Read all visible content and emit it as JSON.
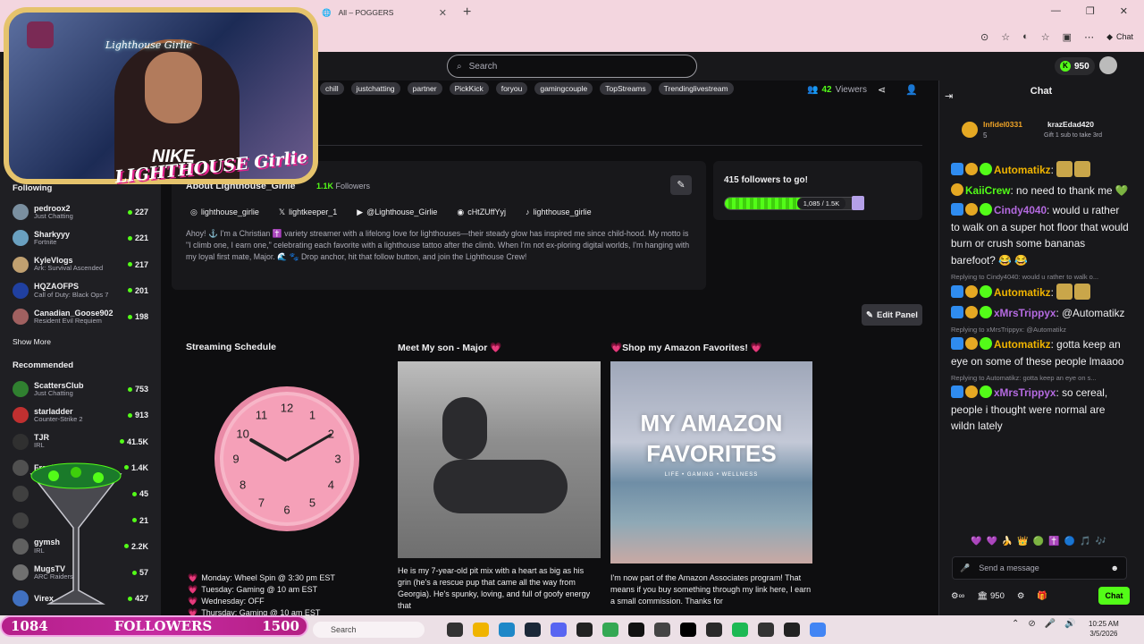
{
  "browser": {
    "tab_title": "All – POGGERS",
    "chat_label": "Chat"
  },
  "topbar": {
    "search_placeholder": "Search",
    "points": "950"
  },
  "webcam": {
    "neon_sign": "Lighthouse Girlie",
    "shirt_text": "NIKE",
    "overlay_logo": "LIGHTHOUSE Girlie"
  },
  "stream": {
    "tags": [
      "chill",
      "justchatting",
      "partner",
      "PickKick",
      "foryou",
      "gamingcouple",
      "TopStreams",
      "Trendinglivestream"
    ],
    "viewers_count": "42",
    "viewers_label": "Viewers"
  },
  "about": {
    "title": "About Lighthouse_Girlie",
    "followers_count": "1.1K",
    "followers_label": "Followers",
    "socials": [
      {
        "icon": "instagram-icon",
        "label": "lighthouse_girlie"
      },
      {
        "icon": "x-icon",
        "label": "lightkeeper_1"
      },
      {
        "icon": "youtube-icon",
        "label": "@Lighthouse_Girlie"
      },
      {
        "icon": "discord-icon",
        "label": "cHtZUffYyj"
      },
      {
        "icon": "tiktok-icon",
        "label": "lighthouse_girlie"
      }
    ],
    "bio": "Ahoy! ⚓ I'm a Christian ✝️ variety streamer with a lifelong love for lighthouses—their steady glow has inspired me since child-hood. My motto is \"I climb one, I earn one,\" celebrating each favorite with a lighthouse tattoo after the climb. When I'm not ex-ploring digital worlds, I'm hanging with my loyal first mate, Major. 🌊 🐾 Drop anchor, hit that follow button, and join the Lighthouse Crew!"
  },
  "goal": {
    "title": "415 followers to go!",
    "progress_label": "1,085 / 1.5K",
    "progress_fraction": 0.72
  },
  "edit_panel_label": "Edit Panel",
  "panels": {
    "schedule_title": "Streaming Schedule",
    "schedule": [
      "Monday: Wheel Spin @ 3:30 pm EST",
      "Tuesday: Gaming @ 10 am EST",
      "Wednesday: OFF",
      "Thursday: Gaming @ 10 am EST"
    ],
    "clock_numbers": [
      "12",
      "1",
      "2",
      "3",
      "4",
      "5",
      "6",
      "7",
      "8",
      "9",
      "10",
      "11"
    ],
    "son_title": "Meet My son - Major 💗",
    "son_text": "He is my 7-year-old pit mix with a heart as big as his grin (he's a rescue pup that came all the way from Georgia). He's spunky, loving, and full of goofy energy that",
    "amazon_title": "💗Shop my Amazon Favorites! 💗",
    "amazon_img_title": "MY AMAZON FAVORITES",
    "amazon_img_sub": "LIFE • GAMING • WELLNESS",
    "amazon_text": "I'm now part of the Amazon Associates program! That means if you buy something through my link here, I earn a small commission. Thanks for"
  },
  "sidebar": {
    "following_title": "Following",
    "following": [
      {
        "name": "pedroox2",
        "game": "Just Chatting",
        "viewers": "227",
        "color": "#7a8fa0"
      },
      {
        "name": "Sharkyyy",
        "game": "Fortnite",
        "viewers": "221",
        "color": "#6aa0c0"
      },
      {
        "name": "KyleVlogs",
        "game": "Ark: Survival Ascended",
        "viewers": "217",
        "color": "#c0a070"
      },
      {
        "name": "HQZAOFPS",
        "game": "Call of Duty: Black Ops 7",
        "viewers": "201",
        "color": "#2040a0"
      },
      {
        "name": "Canadian_Goose902",
        "game": "Resident Evil Requiem",
        "viewers": "198",
        "color": "#a06060"
      }
    ],
    "show_more": "Show More",
    "recommended_title": "Recommended",
    "recommended": [
      {
        "name": "ScattersClub",
        "game": "Just Chatting",
        "viewers": "753",
        "color": "#308030"
      },
      {
        "name": "starladder",
        "game": "Counter-Strike 2",
        "viewers": "913",
        "color": "#c03030"
      },
      {
        "name": "TJR",
        "game": "IRL",
        "viewers": "41.5K",
        "color": "#303030"
      },
      {
        "name": "FrankDimes",
        "game": "",
        "viewers": "1.4K",
        "color": "#505050"
      },
      {
        "name": "",
        "game": "",
        "viewers": "45",
        "color": "#404040"
      },
      {
        "name": "",
        "game": "",
        "viewers": "21",
        "color": "#404040"
      },
      {
        "name": "gymsh",
        "game": "IRL",
        "viewers": "2.2K",
        "color": "#606060"
      },
      {
        "name": "MugsTV",
        "game": "ARC Raiders",
        "viewers": "57",
        "color": "#707070"
      },
      {
        "name": "Virex",
        "game": "",
        "viewers": "427",
        "color": "#4070c0"
      }
    ]
  },
  "chat": {
    "title": "Chat",
    "pinned_user1": "Infidel0331",
    "pinned_sub1": "5",
    "pinned_user2": "krazEdad420",
    "pinned_count2": "1",
    "pinned_gift": "Gift 1 sub to take 3rd",
    "messages": [
      {
        "user": "Automatikz",
        "color": "#f0b400",
        "text": ""
      },
      {
        "user": "KaiiCrew",
        "color": "#53fc18",
        "text": "no need to thank me 💚"
      },
      {
        "user": "Cindy4040",
        "color": "#b46ae0",
        "text": "would u rather to walk on a super hot floor that would burn or crush some bananas barefoot? 😂 😂"
      },
      {
        "reply": "Replying to Cindy4040: would u rather to walk o..."
      },
      {
        "user": "Automatikz",
        "color": "#f0b400",
        "text": ""
      },
      {
        "user": "xMrsTrippyx",
        "color": "#b46ae0",
        "text": "@Automatikz"
      },
      {
        "reply": "Replying to xMrsTrippyx: @Automatikz"
      },
      {
        "user": "Automatikz",
        "color": "#f0b400",
        "text": "gotta keep an eye on some of these people lmaaoo"
      },
      {
        "reply": "Replying to Automatikz: gotta keep an eye on s..."
      },
      {
        "user": "xMrsTrippyx",
        "color": "#b46ae0",
        "text": "so cereal, people i thought were normal are wildn lately"
      }
    ],
    "send_placeholder": "Send a message",
    "footer_points": "950",
    "send_button": "Chat"
  },
  "taskbar": {
    "follow_current": "1084",
    "follow_label": "FOLLOWERS",
    "follow_goal": "1500",
    "search": "Search",
    "time": "10:25 AM",
    "date": "3/5/2026"
  },
  "colors": {
    "accent": "#53fc18",
    "background": "#0e0e10",
    "panel": "#18181b",
    "sidebar": "#1f1f23",
    "browser_chrome": "#f3d6df",
    "follower_strip": "#c52aa0"
  }
}
